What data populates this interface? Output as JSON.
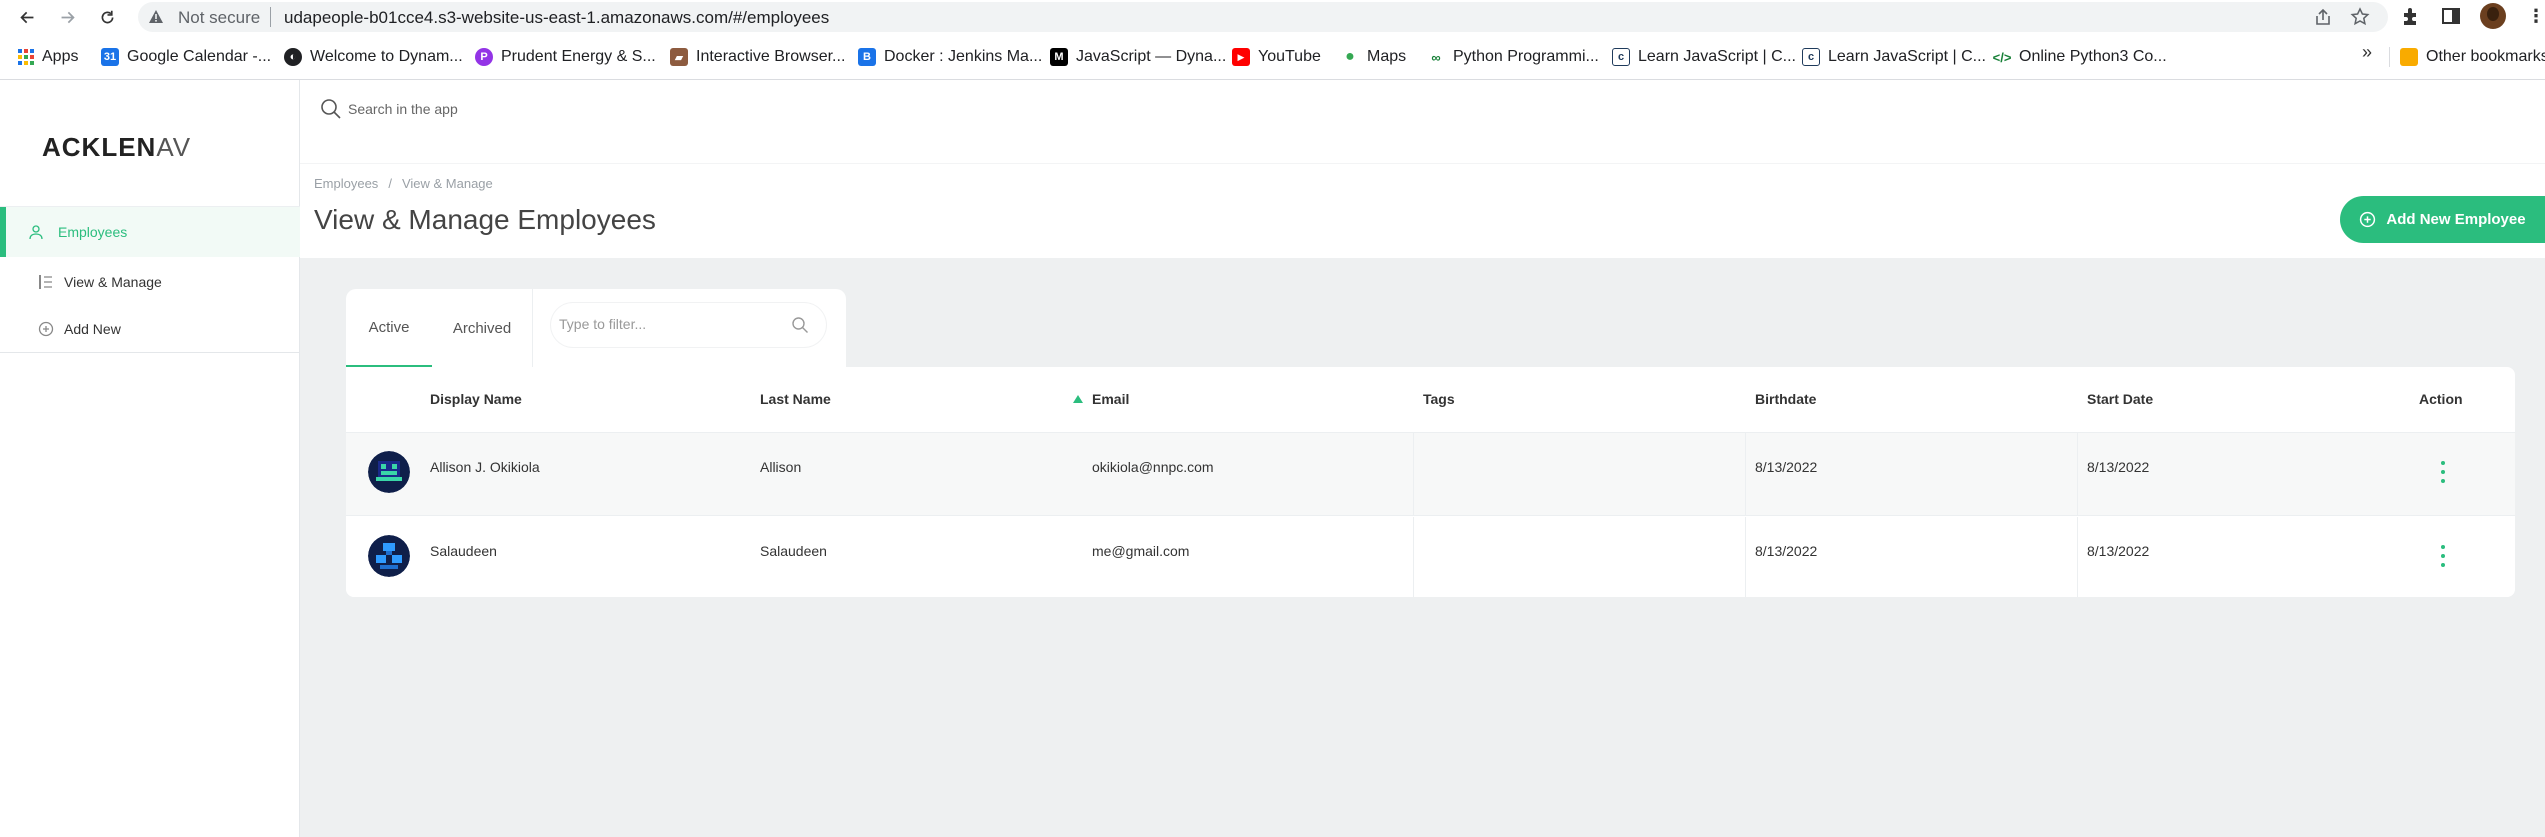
{
  "browser": {
    "security_text": "Not secure",
    "url": "udapeople-b01cce4.s3-website-us-east-1.amazonaws.com/#/employees",
    "bookmarks": [
      {
        "label": "Apps",
        "icon": "apps-grid-icon"
      },
      {
        "label": "Google Calendar -...",
        "icon": "calendar-icon",
        "color": "#1a73e8"
      },
      {
        "label": "Welcome to Dynam...",
        "icon": "globe-icon",
        "color": "#202124"
      },
      {
        "label": "Prudent Energy & S...",
        "icon": "prudent-icon",
        "color": "#9334e6"
      },
      {
        "label": "Interactive Browser...",
        "icon": "browser-icon",
        "color": "#8d5b3f"
      },
      {
        "label": "Docker : Jenkins Ma...",
        "icon": "docker-b-icon",
        "color": "#1a73e8"
      },
      {
        "label": "JavaScript — Dyna...",
        "icon": "medium-icon",
        "color": "#000000"
      },
      {
        "label": "YouTube",
        "icon": "youtube-icon",
        "color": "#ff0000"
      },
      {
        "label": "Maps",
        "icon": "maps-pin-icon",
        "color": "#34a853"
      },
      {
        "label": "Python Programmi...",
        "icon": "python-icon",
        "color": "#188038"
      },
      {
        "label": "Learn JavaScript | C...",
        "icon": "learn-icon",
        "color": "#1f3b5c"
      },
      {
        "label": "Learn JavaScript | C...",
        "icon": "learn-icon",
        "color": "#1f3b5c"
      },
      {
        "label": "Online Python3 Co...",
        "icon": "code-icon",
        "color": "#188038"
      }
    ],
    "more_symbol": "»",
    "other_bookmarks": "Other bookmarks"
  },
  "app": {
    "logo_bold": "ACKLEN",
    "logo_light": "AV",
    "search_placeholder": "Search in the app",
    "sidebar": {
      "section": "Employees",
      "items": [
        {
          "label": "View & Manage",
          "icon": "list-icon"
        },
        {
          "label": "Add New",
          "icon": "plus-circle-icon"
        }
      ]
    },
    "breadcrumb": [
      "Employees",
      "View & Manage"
    ],
    "page_title": "View & Manage Employees",
    "add_button": "Add New Employee",
    "tabs": [
      "Active",
      "Archived"
    ],
    "filter_placeholder": "Type to filter...",
    "columns": [
      "Display Name",
      "Last Name",
      "Email",
      "Tags",
      "Birthdate",
      "Start Date",
      "Action"
    ],
    "rows": [
      {
        "display_name": "Allison J. Okikiola",
        "last_name": "Allison",
        "email": "okikiola@nnpc.com",
        "tags": "",
        "birthdate": "8/13/2022",
        "start_date": "8/13/2022"
      },
      {
        "display_name": "Salaudeen",
        "last_name": "Salaudeen",
        "email": "me@gmail.com",
        "tags": "",
        "birthdate": "8/13/2022",
        "start_date": "8/13/2022"
      }
    ],
    "colors": {
      "accent": "#2bbd7e",
      "background": "#eef0f1"
    }
  }
}
